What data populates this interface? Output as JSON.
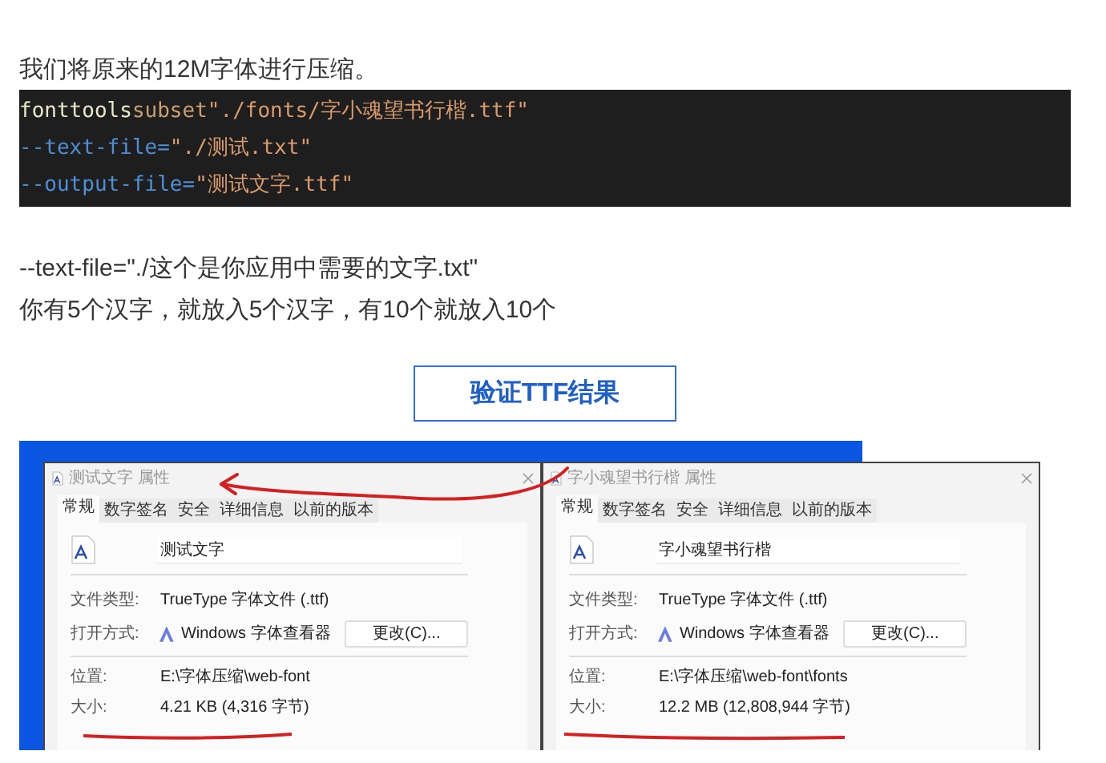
{
  "intro": "我们将原来的12M字体进行压缩。",
  "code_lines": [
    [
      {
        "kind": "command",
        "text": "fonttools"
      },
      {
        "kind": "keyword",
        "text": "subset"
      },
      {
        "kind": "string",
        "text": "\"./fonts/字小魂望书行楷.ttf\""
      }
    ],
    [
      {
        "kind": "option",
        "text": "--text-file="
      },
      {
        "kind": "string",
        "text": "\"./测试.txt\""
      }
    ],
    [
      {
        "kind": "option",
        "text": "--output-file="
      },
      {
        "kind": "string",
        "text": "\"测试文字.ttf\""
      }
    ]
  ],
  "notes": [
    "--text-file=\"./这个是你应用中需要的文字.txt\"",
    "你有5个汉字，就放入5个汉字，有10个就放入10个"
  ],
  "section_button": "验证TTF结果",
  "dialogs": [
    {
      "title": "测试文字 属性",
      "tabs": [
        {
          "label": "常规",
          "selected": true
        },
        {
          "label": "数字签名",
          "selected": false
        },
        {
          "label": "安全",
          "selected": false
        },
        {
          "label": "详细信息",
          "selected": false
        },
        {
          "label": "以前的版本",
          "selected": false
        }
      ],
      "file_name": "测试文字",
      "rows": [
        {
          "kind": "text",
          "label": "文件类型:",
          "value": "TrueType 字体文件 (.ttf)"
        },
        {
          "kind": "app",
          "label": "打开方式:",
          "value": "Windows 字体查看器",
          "button": "更改(C)..."
        },
        {
          "kind": "divider"
        },
        {
          "kind": "text",
          "label": "位置:",
          "value": "E:\\字体压缩\\web-font"
        },
        {
          "kind": "text",
          "label": "大小:",
          "value": "4.21 KB (4,316 字节)"
        }
      ]
    },
    {
      "title": "字小魂望书行楷 属性",
      "tabs": [
        {
          "label": "常规",
          "selected": true
        },
        {
          "label": "数字签名",
          "selected": false
        },
        {
          "label": "安全",
          "selected": false
        },
        {
          "label": "详细信息",
          "selected": false
        },
        {
          "label": "以前的版本",
          "selected": false
        }
      ],
      "file_name": "字小魂望书行楷",
      "rows": [
        {
          "kind": "text",
          "label": "文件类型:",
          "value": "TrueType 字体文件 (.ttf)"
        },
        {
          "kind": "app",
          "label": "打开方式:",
          "value": "Windows 字体查看器",
          "button": "更改(C)..."
        },
        {
          "kind": "divider"
        },
        {
          "kind": "text",
          "label": "位置:",
          "value": "E:\\字体压缩\\web-font\\fonts"
        },
        {
          "kind": "text",
          "label": "大小:",
          "value": "12.2 MB (12,808,944 字节)"
        }
      ]
    }
  ]
}
